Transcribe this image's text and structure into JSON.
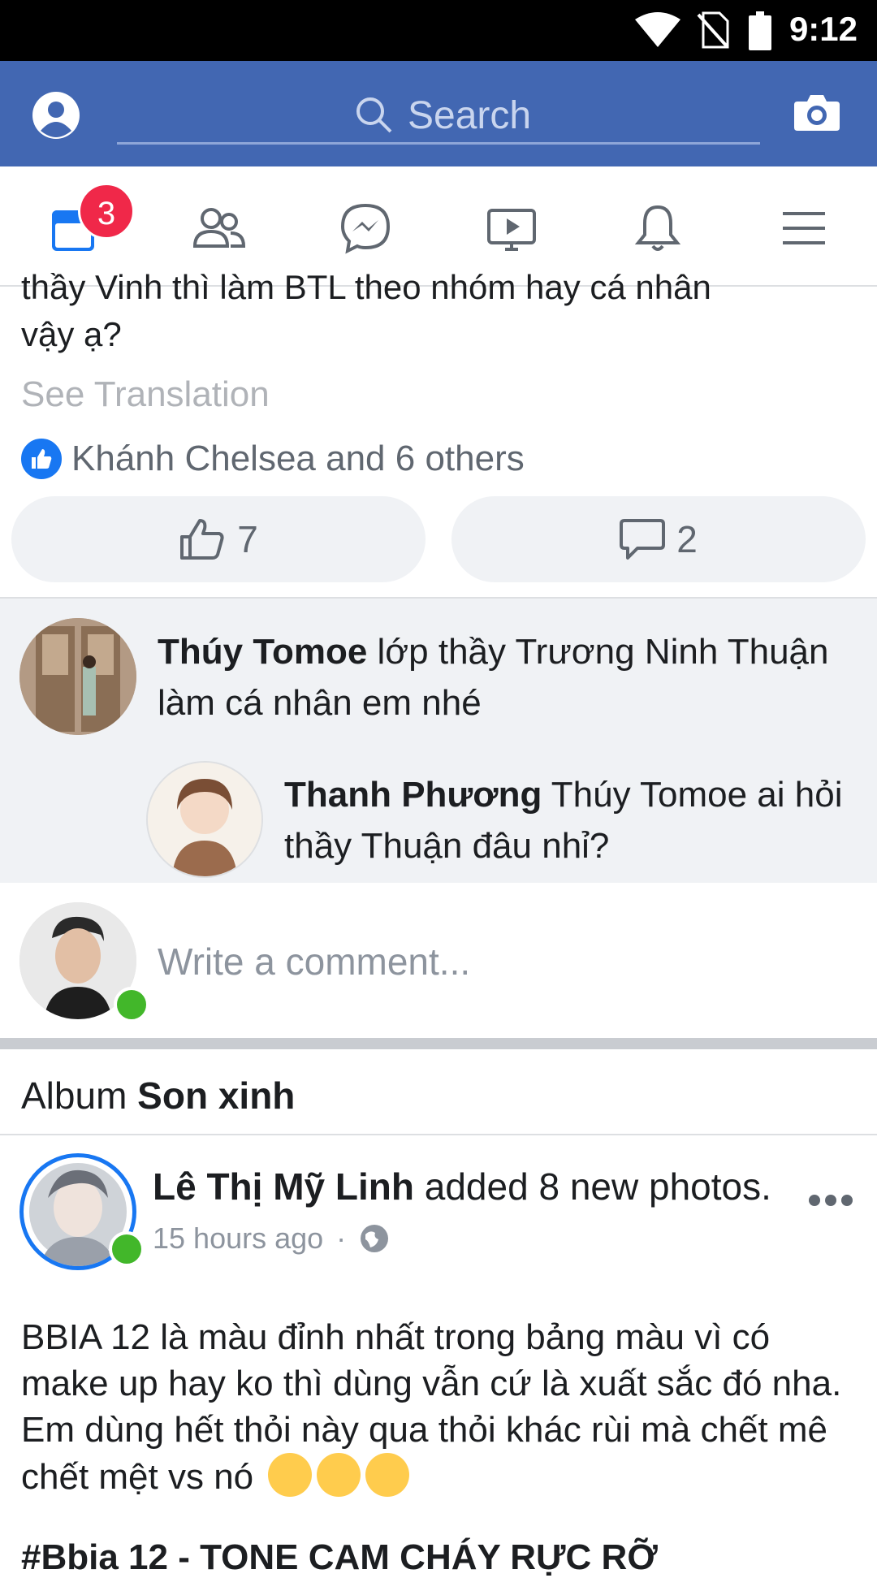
{
  "status_bar": {
    "time": "9:12"
  },
  "header": {
    "search_placeholder": "Search"
  },
  "tabs": {
    "home_badge": "3"
  },
  "post1": {
    "text_partial_top": "thầy Vinh thì làm BTL theo nhóm hay cá nhân",
    "text_line2": "vậy ạ?",
    "see_translation": "See Translation",
    "reactions_text": "Khánh Chelsea and 6 others",
    "like_count": "7",
    "comment_count": "2"
  },
  "comments": [
    {
      "author": "Thúy Tomoe",
      "text": " lớp thầy Trương Ninh Thuận làm cá nhân em nhé"
    },
    {
      "author": "Thanh Phương",
      "text": " Thúy Tomoe ai hỏi thầy Thuận đâu nhỉ?"
    }
  ],
  "write_comment_placeholder": "Write a comment...",
  "album": {
    "prefix": "Album ",
    "name": "Son xinh"
  },
  "post2": {
    "author": "Lê Thị Mỹ Linh",
    "action": " added 8 new photos.",
    "time": "15 hours ago",
    "separator": "·",
    "body": "BBIA 12 là màu đỉnh nhất trong bảng màu vì có make up hay ko thì dùng vẫn cứ là xuất sắc đó nha. Em dùng hết thỏi này qua thỏi khác rùi mà chết mê chết mệt vs nó",
    "cut_line": "#Bbia 12 - TONE CAM CHÁY RỰC RỠ"
  },
  "colors": {
    "brand_blue": "#4267b2",
    "badge_red": "#f02849",
    "online_green": "#42b72a"
  }
}
